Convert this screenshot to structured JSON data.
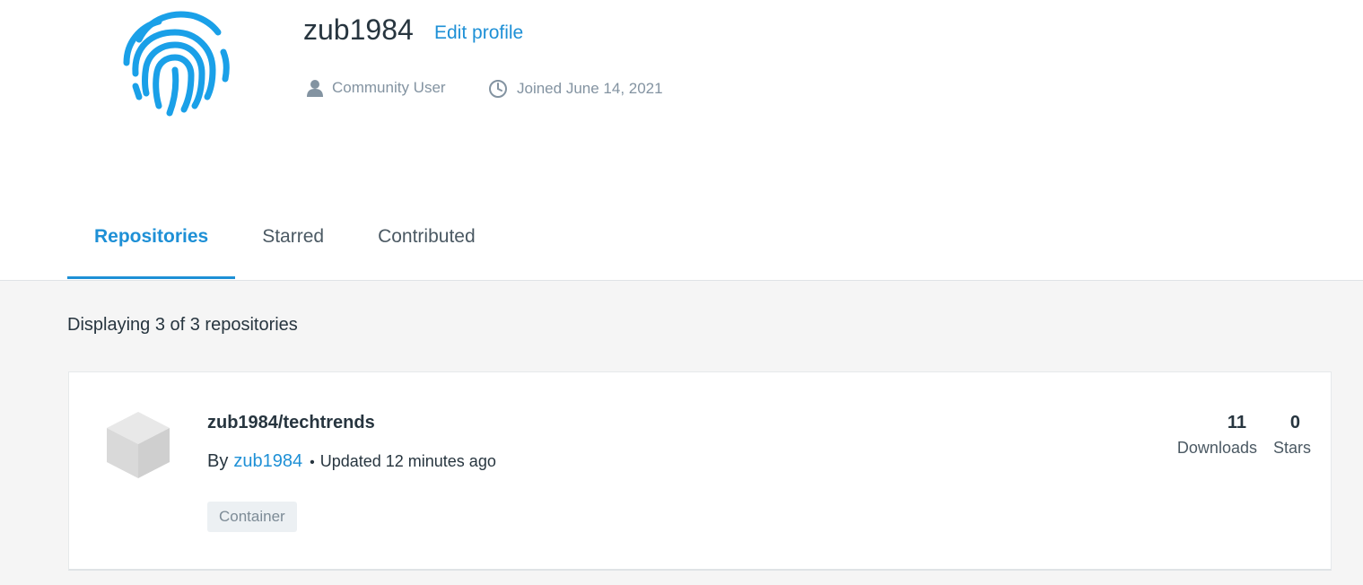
{
  "profile": {
    "username": "zub1984",
    "edit_label": "Edit profile",
    "role": "Community User",
    "joined": "Joined June 14, 2021",
    "avatar_icon": "fingerprint-icon",
    "accent": "#1e90d6"
  },
  "tabs": [
    {
      "label": "Repositories",
      "active": true
    },
    {
      "label": "Starred",
      "active": false
    },
    {
      "label": "Contributed",
      "active": false
    }
  ],
  "listing": {
    "count_text": "Displaying 3 of 3 repositories"
  },
  "repos": [
    {
      "name": "zub1984/techtrends",
      "by_label": "By",
      "owner": "zub1984",
      "updated": "Updated 12 minutes ago",
      "badge": "Container",
      "downloads": "11",
      "downloads_label": "Downloads",
      "stars": "0",
      "stars_label": "Stars",
      "icon": "cube-icon"
    }
  ]
}
